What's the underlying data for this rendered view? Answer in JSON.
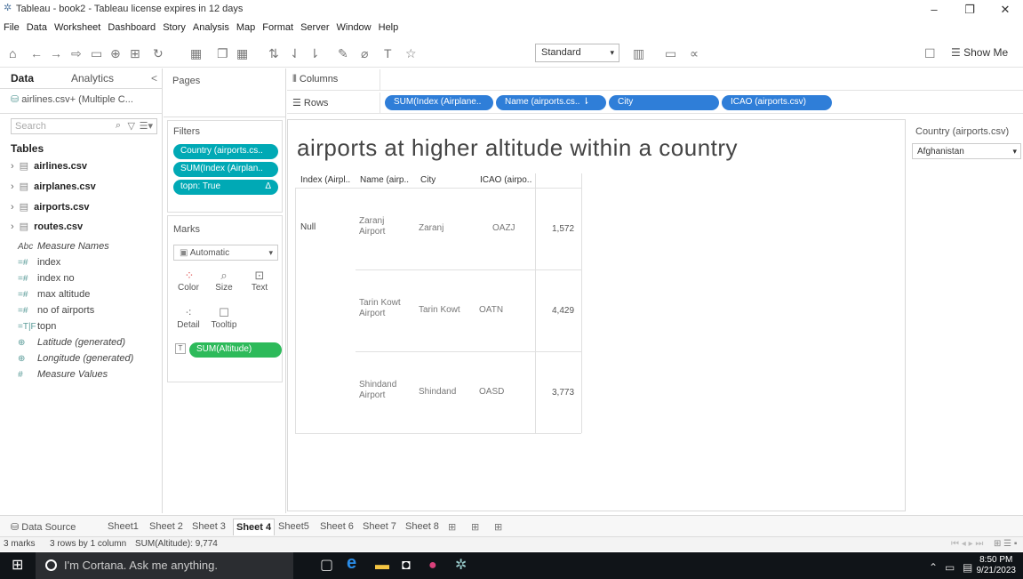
{
  "window": {
    "title": "Tableau - book2 - Tableau license expires in 12 days",
    "minimize": "–",
    "maximize": "❐",
    "close": "✕"
  },
  "menu": [
    "File",
    "Data",
    "Worksheet",
    "Dashboard",
    "Story",
    "Analysis",
    "Map",
    "Format",
    "Server",
    "Window",
    "Help"
  ],
  "toolbar": {
    "fit_select": "Standard",
    "show_me": "Show Me"
  },
  "data_pane": {
    "tab_data": "Data",
    "tab_analytics": "Analytics",
    "collapse": "<",
    "datasource": "airlines.csv+ (Multiple C...",
    "search_placeholder": "Search",
    "tables_heading": "Tables",
    "tables": [
      "airlines.csv",
      "airplanes.csv",
      "airports.csv",
      "routes.csv"
    ],
    "fields": [
      {
        "type": "Abc",
        "name": "Measure Names",
        "italic": true
      },
      {
        "type": "=#",
        "name": "index"
      },
      {
        "type": "=#",
        "name": "index no"
      },
      {
        "type": "=#",
        "name": "max altitude"
      },
      {
        "type": "=#",
        "name": "no of airports"
      },
      {
        "type": "=T|F",
        "name": "topn"
      },
      {
        "type": "⊕",
        "name": "Latitude (generated)",
        "italic": true
      },
      {
        "type": "⊕",
        "name": "Longitude (generated)",
        "italic": true
      },
      {
        "type": "#",
        "name": "Measure Values",
        "italic": true
      }
    ]
  },
  "pages": {
    "heading": "Pages"
  },
  "filters": {
    "heading": "Filters",
    "items": [
      "Country (airports.cs..",
      "SUM(Index (Airplan..",
      "topn: True"
    ],
    "delta": "Δ"
  },
  "marks": {
    "heading": "Marks",
    "type": "Automatic",
    "buttons": [
      "Color",
      "Size",
      "Text",
      "Detail",
      "Tooltip"
    ],
    "text_pill": "SUM(Altitude)"
  },
  "shelves": {
    "columns_label": "Columns",
    "rows_label": "Rows",
    "rows": [
      "SUM(Index (Airplane..",
      "Name (airports.cs.. ⇂",
      "City",
      "ICAO (airports.csv)"
    ]
  },
  "view": {
    "title": "airports at higher altitude within a country",
    "headers": [
      "Index (Airpl..",
      "Name (airp..",
      "City",
      "ICAO (airpo.."
    ],
    "index_value": "Null",
    "rows": [
      {
        "name_l1": "Zaranj",
        "name_l2": "Airport",
        "city": "Zaranj",
        "icao": "OAZJ",
        "altitude": "1,572"
      },
      {
        "name_l1": "Tarin Kowt",
        "name_l2": "Airport",
        "city": "Tarin Kowt",
        "icao": "OATN",
        "altitude": "4,429"
      },
      {
        "name_l1": "Shindand",
        "name_l2": "Airport",
        "city": "Shindand",
        "icao": "OASD",
        "altitude": "3,773"
      }
    ]
  },
  "country_filter": {
    "title": "Country (airports.csv)",
    "value": "Afghanistan"
  },
  "sheet_tabs": {
    "data_source": "Data Source",
    "sheets": [
      "Sheet1",
      "Sheet 2",
      "Sheet 3",
      "Sheet 4",
      "Sheet5",
      "Sheet 6",
      "Sheet 7",
      "Sheet 8"
    ],
    "active": "Sheet 4"
  },
  "status": {
    "marks": "3 marks",
    "dims": "3 rows by 1 column",
    "sum": "SUM(Altitude): 9,774"
  },
  "taskbar": {
    "cortana": "I'm Cortana. Ask me anything.",
    "time": "8:50 PM",
    "date": "9/21/2023"
  }
}
